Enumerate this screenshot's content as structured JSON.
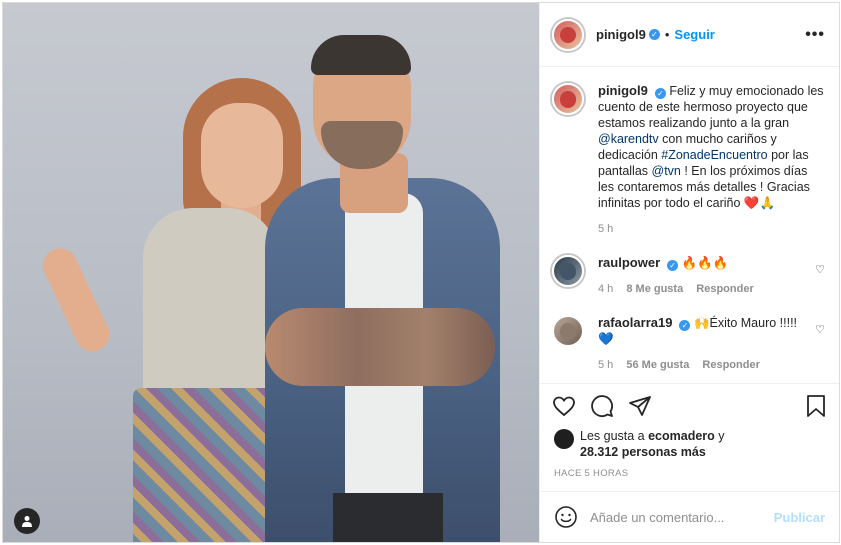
{
  "post": {
    "author": "pinigol9",
    "follow_label": "Seguir",
    "dot": "•",
    "more_icon": "more-horizontal-icon",
    "caption_author": "pinigol9",
    "caption_part1": "Feliz y muy emocionado les cuento de este hermoso proyecto que estamos realizando junto a la gran ",
    "mention1": "@karendtv",
    "caption_part2": " con mucho cariños y dedicación ",
    "hashtag": "#ZonadeEncuentro",
    "caption_part3": " por las pantallas ",
    "mention2": "@tvn",
    "caption_part4": " ! En los próximos días les contaremos más detalles ! Gracias infinitas por todo el cariño ❤️🙏",
    "caption_time": "5 h"
  },
  "comments": [
    {
      "user": "raulpower",
      "verified": true,
      "text": "🔥🔥🔥",
      "time": "4 h",
      "likes": "8 Me gusta",
      "reply": "Responder"
    },
    {
      "user": "rafaolarra19",
      "verified": true,
      "text": "🙌Éxito Mauro !!!!!💙",
      "time": "5 h",
      "likes": "56 Me gusta",
      "reply": "Responder"
    }
  ],
  "likes_section": {
    "prefix": "Les gusta a ",
    "liker": "ecomadero",
    "middle": " y",
    "count": "28.312 personas más"
  },
  "timestamp": "HACE 5 HORAS",
  "add_comment": {
    "placeholder": "Añade un comentario...",
    "publish_label": "Publicar"
  },
  "colors": {
    "accent": "#0095f6",
    "link": "#00376b",
    "publish_disabled": "#b2dffc",
    "muted": "#8e8e8e"
  }
}
